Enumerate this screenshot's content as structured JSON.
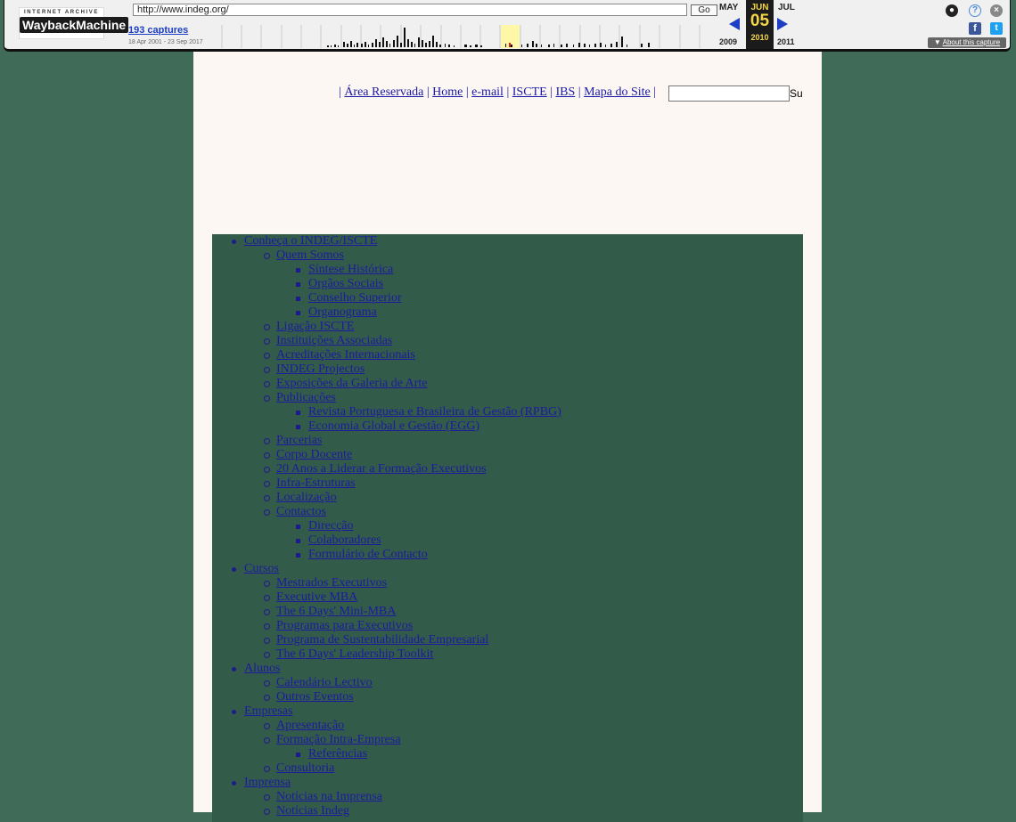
{
  "wayback": {
    "logo_top": "INTERNET ARCHIVE",
    "logo_main": "WaybackMachine",
    "url": "http://www.indeg.org/",
    "go_label": "Go",
    "captures": "193 captures",
    "range": "18 Apr 2001 - 23 Sep 2017",
    "prev_month": "MAY",
    "cur_month": "JUN",
    "next_month": "JUL",
    "day": "05",
    "prev_year": "2009",
    "cur_year": "2010",
    "next_year": "2011",
    "about": "About this capture",
    "icons": [
      "user-icon",
      "help-icon",
      "close-icon",
      "facebook-icon",
      "twitter-icon"
    ],
    "colors": {
      "accent": "#1d3ec4",
      "highlight": "#f4d54a"
    }
  },
  "toplinks": {
    "area": "Área Reservada",
    "home": "Home",
    "email": "e-mail",
    "iscte": "ISCTE",
    "ibs": "IBS",
    "mapa": "Mapa do Site",
    "sep": "|",
    "search_button": "Su"
  },
  "menu": {
    "conheca": "Conheça o INDEG/ISCTE",
    "quem_somos": "Quem Somos",
    "sintese": "Síntese Histórica",
    "orgaos": "Orgãos Sociais",
    "conselho": "Conselho Superior",
    "organograma": "Organograma",
    "ligacao": "Ligação ISCTE",
    "instituicoes": "Instituições Associadas",
    "acreditacoes": "Acreditações Internacionais",
    "projectos": "INDEG Projectos",
    "exposicoes": "Exposições da Galeria de Arte",
    "publicacoes": "Publicações",
    "rpbg": "Revista Portuguesa e Brasileira de Gestão (RPBG)",
    "egg": "Economia Global e Gestão (EGG)",
    "parcerias": "Parcerias",
    "corpo": "Corpo Docente",
    "vinte_anos": "20 Anos a Liderar a Formação Executivos",
    "infra": "Infra-Estruturas",
    "localizacao": "Localização",
    "contactos": "Contactos",
    "direccao": "Direcção",
    "colaboradores": "Colaboradores",
    "formulario": "Formulário de Contacto",
    "cursos": "Cursos",
    "mestrados": "Mestrados Executivos",
    "mba": "Executive MBA",
    "mini_mba": "The 6 Days' Mini-MBA",
    "programas": "Programas para Executivos",
    "sustentabilidade": "Programa de Sustentabilidade Empresarial",
    "leadership": "The 6 Days' Leadership Toolkit",
    "alunos": "Alunos",
    "calendario": "Calendário Lectivo",
    "eventos": "Outros Eventos",
    "empresas": "Empresas",
    "apresentacao": "Apresentação",
    "formacao_intra": "Formação Intra-Empresa",
    "referencias": "Referências",
    "consultoria": "Consultoria",
    "imprensa": "Imprensa",
    "noticias_imprensa": "Notícias na Imprensa",
    "noticias_indeg": "Notícias Indeg"
  }
}
